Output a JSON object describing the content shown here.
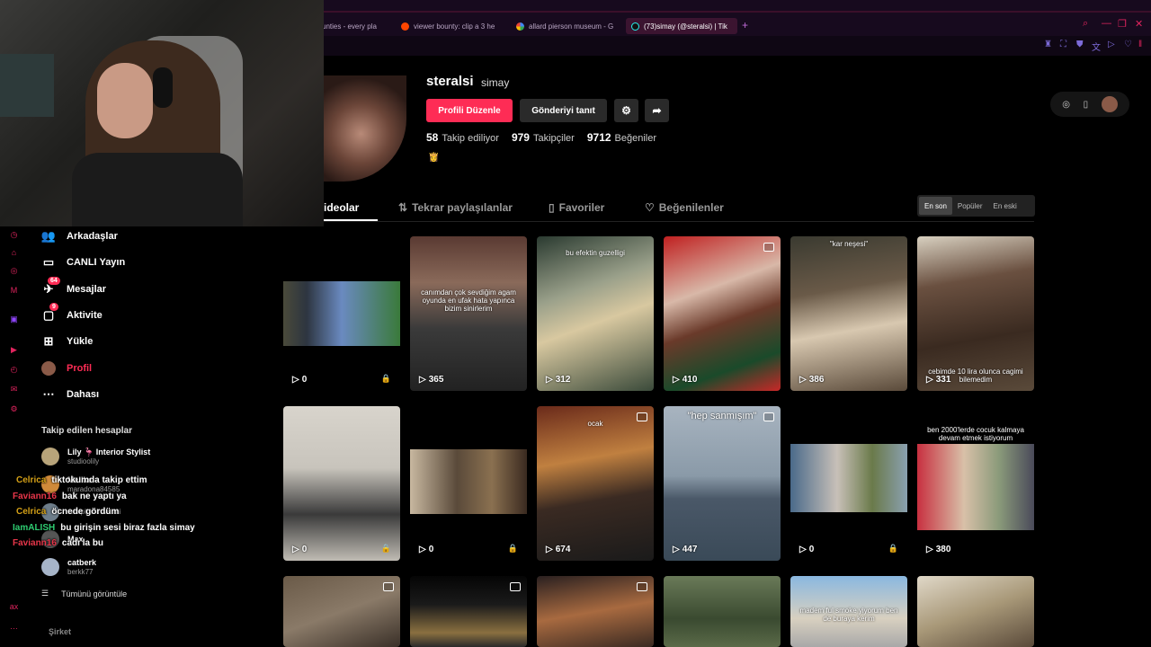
{
  "browser": {
    "tabs": [
      {
        "label": "unties - every pla",
        "icon": "tab-favicon",
        "active": false
      },
      {
        "label": "viewer bounty: clip a 3 he",
        "icon": "reddit-icon",
        "active": false
      },
      {
        "label": "allard pierson museum - G",
        "icon": "google-icon",
        "active": false
      },
      {
        "label": "(73)simay (@steralsi) | Tik",
        "icon": "tiktok-icon",
        "active": true
      }
    ],
    "new_tab": "+"
  },
  "profile": {
    "username": "steralsi",
    "nickname": "simay",
    "edit_button": "Profili Düzenle",
    "promote_button": "Gönderiyi tanıt",
    "stats": [
      {
        "value": "58",
        "label": "Takip ediliyor"
      },
      {
        "value": "979",
        "label": "Takipçiler"
      },
      {
        "value": "9712",
        "label": "Beğeniler"
      }
    ],
    "bio_emoji": "👸"
  },
  "profile_tabs": [
    {
      "label": "ideolar",
      "active": true
    },
    {
      "label": "Tekrar paylaşılanlar",
      "active": false
    },
    {
      "label": "Favoriler",
      "active": false
    },
    {
      "label": "Beğenilenler",
      "active": false
    }
  ],
  "sort": [
    "En son",
    "Popüler",
    "En eski"
  ],
  "sidebar": {
    "items": [
      {
        "label": "Arkadaşlar",
        "icon": "friends-icon"
      },
      {
        "label": "CANLI Yayın",
        "icon": "live-icon"
      },
      {
        "label": "Mesajlar",
        "icon": "messages-icon",
        "badge": "64"
      },
      {
        "label": "Aktivite",
        "icon": "activity-icon",
        "badge": "9"
      },
      {
        "label": "Yükle",
        "icon": "upload-icon"
      },
      {
        "label": "Profil",
        "icon": "profile-icon",
        "active": true
      },
      {
        "label": "Dahası",
        "icon": "more-icon"
      }
    ],
    "following_title": "Takip edilen hesaplar",
    "following": [
      {
        "name": "Lily 🦩 Interior Stylist",
        "handle": "studioolily"
      },
      {
        "name": "Melike",
        "handle": "maradona84585"
      },
      {
        "name": "",
        "handle": "senipbacinivarmi"
      },
      {
        "name": "Max",
        "handle": ""
      },
      {
        "name": "catberk",
        "handle": "berkk77"
      }
    ],
    "see_all": "Tümünü görüntüle",
    "company": "Şirket"
  },
  "chat": [
    {
      "user": "Celrica",
      "color": "#d4a017",
      "msg": "tiktokumda takip ettim"
    },
    {
      "user": "Faviann16",
      "color": "#e8364a",
      "msg": "bak ne yaptı ya"
    },
    {
      "user": "Celrica",
      "color": "#d4a017",
      "msg": "öcnede gördüm"
    },
    {
      "user": "IamALISH",
      "color": "#2ecc71",
      "msg": "bu girişin sesi biraz fazla simay"
    },
    {
      "user": "Faviann16",
      "color": "#e8364a",
      "msg": "cadı la bu"
    }
  ],
  "videos": [
    {
      "views": "0",
      "lock": true,
      "caption": "",
      "photo": false
    },
    {
      "views": "365",
      "lock": false,
      "caption": "canımdan çok sevdiğim agam oyunda en ufak hata yapınca bizim sinirlerim",
      "photo": false
    },
    {
      "views": "312",
      "lock": false,
      "caption": "bu efektin guzelligi",
      "photo": false
    },
    {
      "views": "410",
      "lock": false,
      "caption": "",
      "photo": true
    },
    {
      "views": "386",
      "lock": false,
      "caption": "''kar neşesi''",
      "photo": false
    },
    {
      "views": "331",
      "lock": false,
      "caption": "cebimde 10 lira olunca cagimi bilemedim",
      "photo": false
    },
    {
      "views": "0",
      "lock": true,
      "caption": "",
      "photo": false
    },
    {
      "views": "0",
      "lock": true,
      "caption": "",
      "photo": false
    },
    {
      "views": "674",
      "lock": false,
      "caption": "ocak",
      "photo": true
    },
    {
      "views": "447",
      "lock": false,
      "caption": "\"hep sanmışım\"",
      "photo": true
    },
    {
      "views": "0",
      "lock": true,
      "caption": "",
      "photo": false
    },
    {
      "views": "380",
      "lock": false,
      "caption": "ben 2000'lerde cocuk kalmaya devam etmek istiyorum",
      "photo": false
    },
    {
      "views": "",
      "lock": false,
      "caption": "",
      "photo": true
    },
    {
      "views": "",
      "lock": false,
      "caption": "",
      "photo": true
    },
    {
      "views": "",
      "lock": false,
      "caption": "",
      "photo": true
    },
    {
      "views": "",
      "lock": false,
      "caption": "",
      "photo": false
    },
    {
      "views": "",
      "lock": false,
      "caption": "madem ful smoke yiyorum ben de buraya kerim",
      "photo": false
    },
    {
      "views": "",
      "lock": false,
      "caption": "",
      "photo": false
    }
  ],
  "colors": {
    "accent": "#fe2c55",
    "background": "#000000"
  }
}
